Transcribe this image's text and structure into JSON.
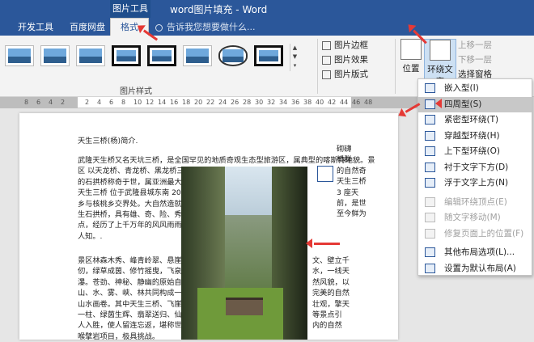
{
  "titlebar": {
    "context_tab": "图片工具",
    "title": "word图片填充 - Word"
  },
  "tabs": [
    "开发工具",
    "百度网盘",
    "格式"
  ],
  "tellme": "告诉我您想要做什么...",
  "ribbon": {
    "picture_styles_label": "图片样式",
    "commands": [
      "图片边框",
      "图片效果",
      "图片版式"
    ],
    "position_label": "位置",
    "wrap_text_label": "环绕文字",
    "right_commands": [
      "上移一层",
      "下移一层",
      "选择窗格"
    ]
  },
  "ruler_ticks": [
    "8",
    "6",
    "4",
    "2",
    "",
    "2",
    "4",
    "6",
    "8",
    "10",
    "12",
    "14",
    "16",
    "18",
    "20",
    "22",
    "24",
    "26",
    "28",
    "30",
    "32",
    "34",
    "36",
    "38",
    "40",
    "42",
    "44",
    "46",
    "48"
  ],
  "document": {
    "heading": "天生三桥(杨)简介.",
    "para1_lines": [
      "武隆天生桥又名天坑三桥，是全国罕见的地质奇观生态型旅游区，属典型的喀斯特地貌。景",
      "区 以天龙桥、青龙桥、黑龙桥三",
      "的石拱桥称奇于世，属亚洲最大",
      "天生三桥 位于武隆县城东南 20",
      "乡与核桃乡交界处。大自然造就",
      "生石拱桥，具有雄、奇、险、秀、",
      "点，经历了上千万年的风风雨雨、",
      "人知。."
    ],
    "para2_lines": [
      "景区林森木秀、峰青岭翠、悬崖万",
      "仞，绿草成茵、修竹摇曳，飞泉流",
      "瀑。苍劲、神秘、静幽的原始自",
      "山、水、雾、峡、林共同构成一幅",
      "山水画卷。其中天生三桥、飞崖",
      "一柱、绿茵生辉、翡翠送归、仙女",
      "人入胜，使人留连忘返，堪称世界",
      "喉擘岩项目，极具挑战。"
    ],
    "right_lines": [
      "砌礴",
      "桥群",
      "的自然奇",
      "天生三桥",
      "3 座天",
      "前，是世",
      "至今鲜为",
      "文、壁立千",
      "水，一线天",
      "然风貌，以",
      "完美的自然",
      "壮观，擎天",
      "等景点引",
      "内的自然"
    ]
  },
  "dropdown": {
    "items": [
      {
        "label": "嵌入型(I)",
        "enabled": true,
        "highlighted": false
      },
      {
        "label": "四周型(S)",
        "enabled": true,
        "highlighted": true
      },
      {
        "label": "紧密型环绕(T)",
        "enabled": true,
        "highlighted": false
      },
      {
        "label": "穿越型环绕(H)",
        "enabled": true,
        "highlighted": false
      },
      {
        "label": "上下型环绕(O)",
        "enabled": true,
        "highlighted": false
      },
      {
        "label": "衬于文字下方(D)",
        "enabled": true,
        "highlighted": false
      },
      {
        "label": "浮于文字上方(N)",
        "enabled": true,
        "highlighted": false
      },
      {
        "label": "编辑环绕顶点(E)",
        "enabled": false,
        "highlighted": false
      },
      {
        "label": "随文字移动(M)",
        "enabled": false,
        "highlighted": false
      },
      {
        "label": "修复页面上的位置(F)",
        "enabled": false,
        "highlighted": false
      },
      {
        "label": "其他布局选项(L)...",
        "enabled": true,
        "highlighted": false
      },
      {
        "label": "设置为默认布局(A)",
        "enabled": true,
        "highlighted": false
      }
    ]
  },
  "colors": {
    "accent": "#2b579a",
    "highlight": "#c8c8c8",
    "arrow": "#e53935"
  }
}
